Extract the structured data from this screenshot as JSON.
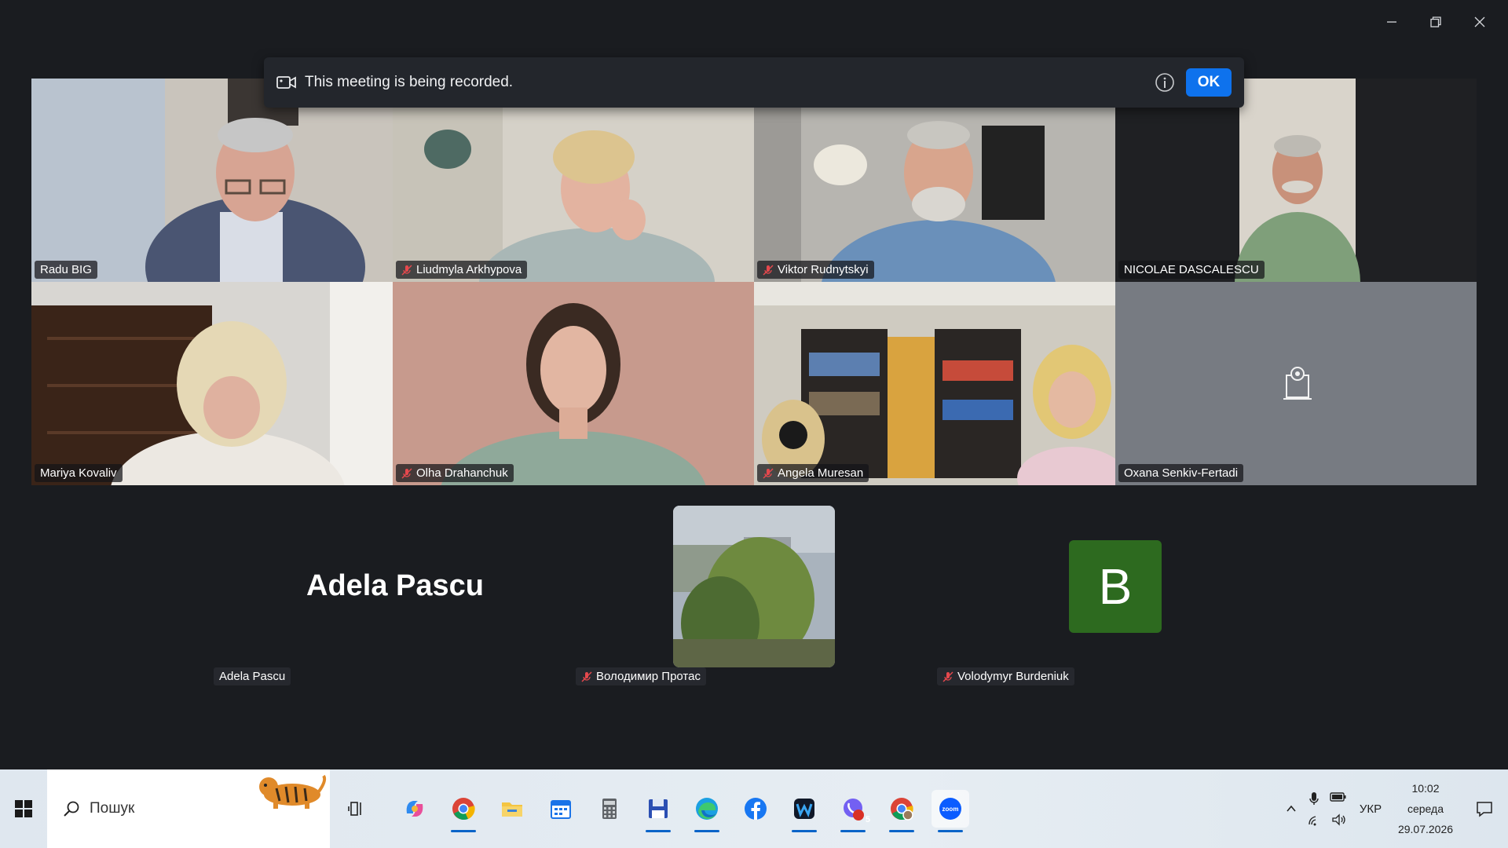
{
  "banner": {
    "message": "This meeting is being recorded.",
    "ok_label": "OK"
  },
  "gallery": {
    "tiles": [
      {
        "name": "Radu BIG",
        "muted": false
      },
      {
        "name": "Liudmyla Arkhypova",
        "muted": true
      },
      {
        "name": "Viktor Rudnytskyi",
        "muted": true
      },
      {
        "name": "NICOLAE DASCALESCU",
        "muted": false
      },
      {
        "name": "Mariya Kovaliv",
        "muted": false
      },
      {
        "name": "Olha Drahanchuk",
        "muted": true
      },
      {
        "name": "Angela Muresan",
        "muted": true
      },
      {
        "name": "Oxana Senkiv-Fertadi",
        "muted": false
      }
    ]
  },
  "bottom": {
    "big_name": "Adela Pascu",
    "participants": [
      {
        "name": "Adela Pascu"
      },
      {
        "name": "Володимир Протас"
      },
      {
        "name": "Volodymyr Burdeniuk"
      }
    ],
    "avatar_letter": "B"
  },
  "taskbar": {
    "search_label": "Пошук",
    "language": "УКР",
    "time": "10:02",
    "weekday": "середа",
    "date": "29.07.2026",
    "badge_count": "5",
    "zoom_label": "zoom"
  },
  "colors": {
    "accent": "#0e72ed",
    "active_speaker": "#1fd47a",
    "avatar_bg": "#2d6a1f",
    "muted_red": "#e5484d"
  }
}
